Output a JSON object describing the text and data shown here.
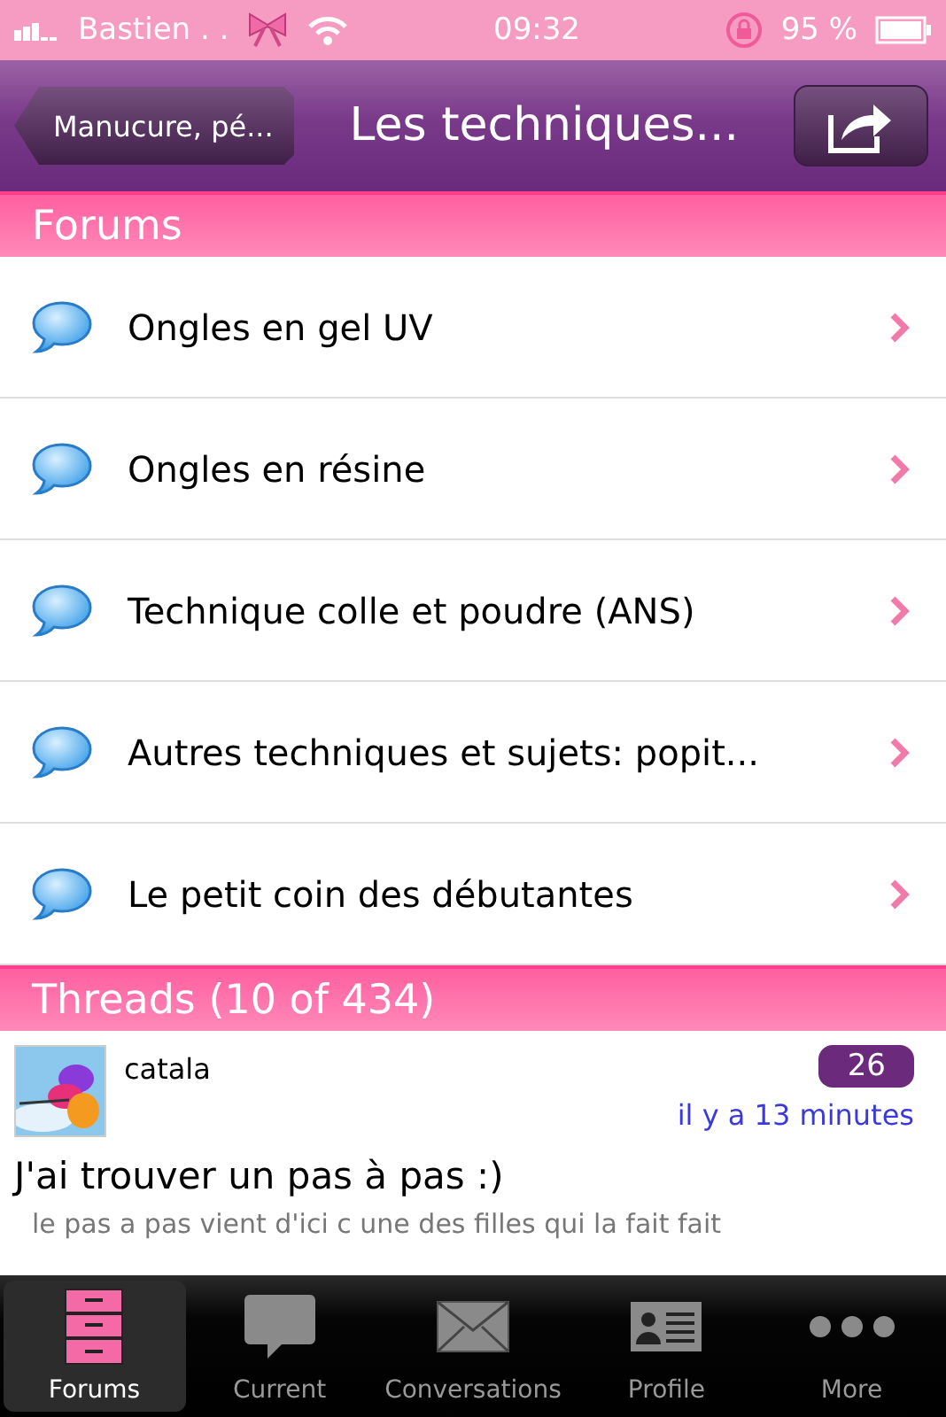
{
  "status_bar": {
    "carrier": "Bastien . .",
    "time": "09:32",
    "battery": "95 %"
  },
  "nav_bar": {
    "back": "Manucure, pé...",
    "title": "Les techniques..."
  },
  "forums": {
    "header": "Forums",
    "items": [
      {
        "title": "Ongles en gel UV"
      },
      {
        "title": "Ongles en résine"
      },
      {
        "title": "Technique colle et poudre (ANS)"
      },
      {
        "title": "Autres techniques et sujets: popit..."
      },
      {
        "title": "Le petit coin des débutantes"
      }
    ]
  },
  "threads": {
    "header": "Threads (10 of 434)",
    "items": [
      {
        "author": "catala",
        "replies": "26",
        "time": "il y a 13 minutes",
        "title": "J'ai trouver un pas à pas :)",
        "preview": "le pas a pas vient d'ici c une des filles qui la fait fait"
      }
    ]
  },
  "tab_bar": [
    {
      "label": "Forums",
      "kind": "cabinet",
      "selected": true
    },
    {
      "label": "Current",
      "kind": "bubble",
      "selected": false
    },
    {
      "label": "Conversations",
      "kind": "envelope",
      "selected": false
    },
    {
      "label": "Profile",
      "kind": "card",
      "selected": false
    },
    {
      "label": "More",
      "kind": "dots",
      "selected": false
    }
  ]
}
